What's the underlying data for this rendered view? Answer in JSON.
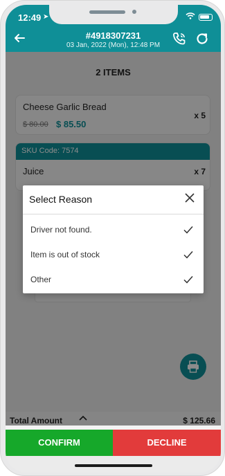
{
  "status": {
    "time": "12:49"
  },
  "header": {
    "order_number": "#4918307231",
    "order_date": "03 Jan, 2022 (Mon),  12:48 PM"
  },
  "content": {
    "items_count": "2 ITEMS",
    "items": [
      {
        "name": "Cheese Garlic Bread",
        "old_price": "$ 80.00",
        "price": "$ 85.50",
        "qty": "x 5"
      },
      {
        "sku": "SKU Code: 7574",
        "name": "Juice",
        "qty": "x 7"
      }
    ]
  },
  "footer": {
    "total_label": "Total Amount",
    "total_value": "$ 125.66",
    "confirm_label": "CONFIRM",
    "decline_label": "DECLINE"
  },
  "modal": {
    "title": "Select Reason",
    "reasons": [
      {
        "label": "Driver not found."
      },
      {
        "label": "Item is out of stock"
      },
      {
        "label": "Other"
      }
    ]
  },
  "colors": {
    "accent": "#0f8f97",
    "confirm": "#16a82a",
    "decline": "#e23b3b"
  }
}
